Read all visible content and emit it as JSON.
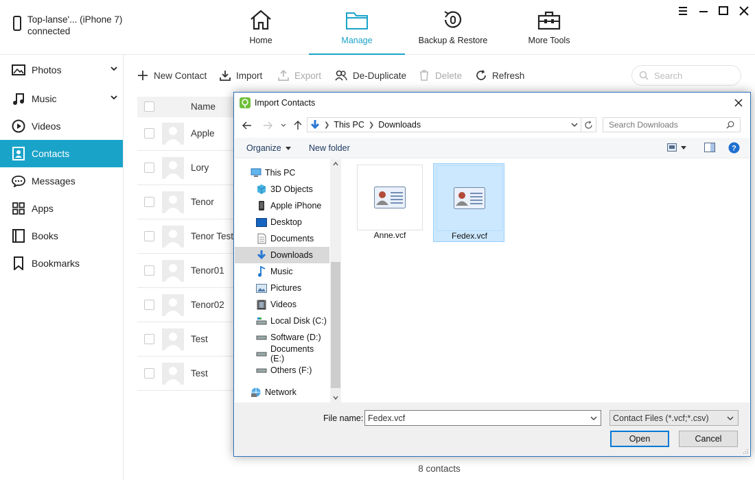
{
  "header": {
    "device_name": "Top-lanse'... (iPhone 7)",
    "device_status": "connected",
    "tabs": [
      {
        "label": "Home",
        "icon": "home-icon"
      },
      {
        "label": "Manage",
        "icon": "folder-icon"
      },
      {
        "label": "Backup & Restore",
        "icon": "backup-restore-icon"
      },
      {
        "label": "More Tools",
        "icon": "toolbox-icon"
      }
    ],
    "active_tab": "Manage",
    "accent_color": "#1aa3c9"
  },
  "sidebar": {
    "items": [
      {
        "label": "Photos",
        "icon": "photo-icon"
      },
      {
        "label": "Music",
        "icon": "music-note-icon"
      },
      {
        "label": "Videos",
        "icon": "play-circle-icon"
      },
      {
        "label": "Contacts",
        "icon": "contact-card-icon"
      },
      {
        "label": "Messages",
        "icon": "chat-bubble-icon"
      },
      {
        "label": "Apps",
        "icon": "apps-grid-icon"
      },
      {
        "label": "Books",
        "icon": "book-icon"
      },
      {
        "label": "Bookmarks",
        "icon": "bookmark-icon"
      }
    ],
    "active": "Contacts"
  },
  "toolbar": {
    "new_contact": "New Contact",
    "import": "Import",
    "export": "Export",
    "deduplicate": "De-Duplicate",
    "delete": "Delete",
    "refresh": "Refresh",
    "search_placeholder": "Search"
  },
  "contacts": {
    "column_name": "Name",
    "rows": [
      "Apple",
      "Lory",
      "Tenor",
      "Tenor Test",
      "Tenor01",
      "Tenor02",
      "Test",
      "Test"
    ],
    "count_text": "8 contacts"
  },
  "dialog": {
    "title": "Import Contacts",
    "breadcrumb": [
      "This PC",
      "Downloads"
    ],
    "search_placeholder": "Search Downloads",
    "organize": "Organize",
    "new_folder": "New folder",
    "tree": [
      {
        "label": "This PC",
        "icon": "computer-icon"
      },
      {
        "label": "3D Objects",
        "icon": "cube-icon"
      },
      {
        "label": "Apple iPhone",
        "icon": "phone-icon"
      },
      {
        "label": "Desktop",
        "icon": "desktop-icon"
      },
      {
        "label": "Documents",
        "icon": "document-icon"
      },
      {
        "label": "Downloads",
        "icon": "download-arrow-icon"
      },
      {
        "label": "Music",
        "icon": "music-note-icon"
      },
      {
        "label": "Pictures",
        "icon": "picture-icon"
      },
      {
        "label": "Videos",
        "icon": "film-icon"
      },
      {
        "label": "Local Disk (C:)",
        "icon": "disk-icon"
      },
      {
        "label": "Software (D:)",
        "icon": "drive-icon"
      },
      {
        "label": "Documents (E:)",
        "icon": "drive-icon"
      },
      {
        "label": "Others (F:)",
        "icon": "drive-icon"
      },
      {
        "label": "Network",
        "icon": "network-icon"
      }
    ],
    "tree_selected": "Downloads",
    "files": [
      {
        "name": "Anne.vcf",
        "selected": false
      },
      {
        "name": "Fedex.vcf",
        "selected": true
      }
    ],
    "file_name_label": "File name:",
    "file_name_value": "Fedex.vcf",
    "file_type": "Contact Files (*.vcf;*.csv)",
    "open_button": "Open",
    "cancel_button": "Cancel"
  }
}
